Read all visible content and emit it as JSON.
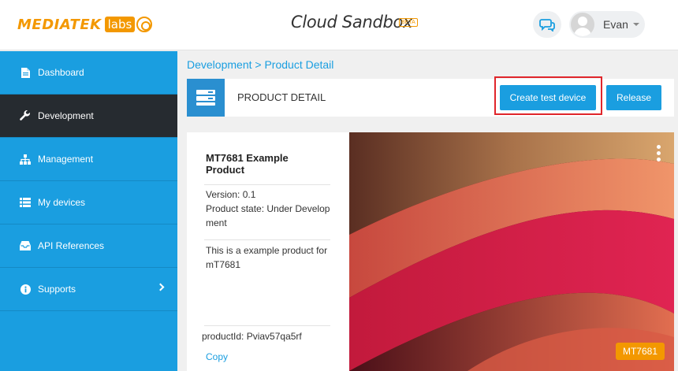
{
  "header": {
    "logo_text": "MEDIATEK",
    "logo_labs": "labs",
    "app_title": "Cloud Sandbox",
    "beta_badge": "BETA",
    "user_name": "Evan"
  },
  "sidebar": {
    "items": [
      {
        "label": "Dashboard",
        "icon": "document-icon"
      },
      {
        "label": "Development",
        "icon": "wrench-icon"
      },
      {
        "label": "Management",
        "icon": "hierarchy-icon"
      },
      {
        "label": "My devices",
        "icon": "list-icon"
      },
      {
        "label": "API References",
        "icon": "inbox-icon"
      },
      {
        "label": "Supports",
        "icon": "info-icon"
      }
    ]
  },
  "breadcrumb": {
    "part1": "Development",
    "separator": " > ",
    "part2": "Product Detail"
  },
  "page": {
    "title": "PRODUCT DETAIL",
    "create_button": "Create test device",
    "release_button": "Release"
  },
  "product": {
    "name": "MT7681 Example Product",
    "version": "Version: 0.1",
    "state": "Product state: Under Development",
    "description": "This is a example product for mT7681",
    "product_id": "productId: Pviav57qa5rf",
    "copy_label": "Copy",
    "chip_label": "MT7681"
  },
  "colors": {
    "brand": "#f39800",
    "sidebar": "#1a9ee0",
    "active": "#262b30",
    "highlight": "#e0262b"
  }
}
